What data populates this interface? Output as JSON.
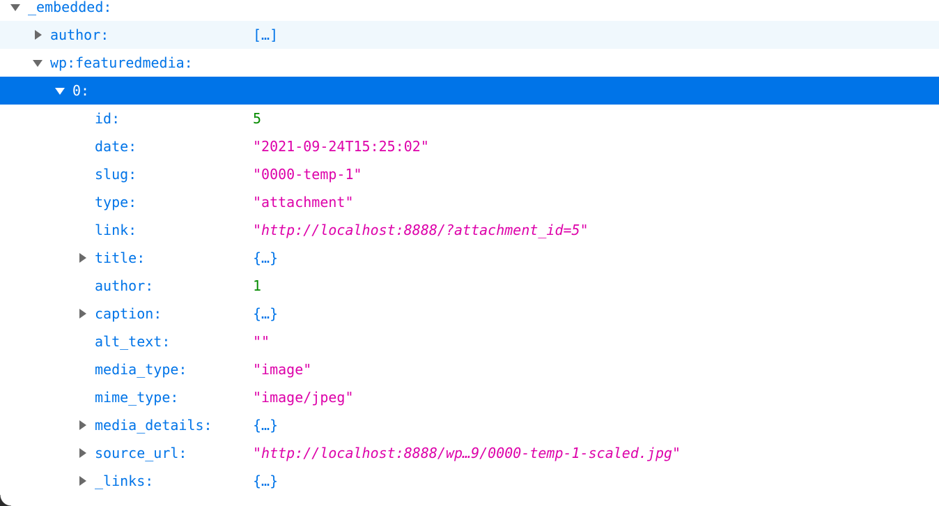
{
  "tree": {
    "rows": [
      {
        "key": "_embedded:",
        "value": "",
        "type": "none",
        "depth": 0,
        "twisty": "expanded",
        "state": ""
      },
      {
        "key": "author:",
        "value": "[…]",
        "type": "obj",
        "depth": 1,
        "twisty": "collapsed",
        "state": "hover"
      },
      {
        "key": "wp:featuredmedia:",
        "value": "",
        "type": "none",
        "depth": 1,
        "twisty": "expanded",
        "state": ""
      },
      {
        "key": "0:",
        "value": "",
        "type": "none",
        "depth": 2,
        "twisty": "expanded",
        "state": "selected"
      },
      {
        "key": "id:",
        "value": "5",
        "type": "number",
        "depth": 3,
        "twisty": "none",
        "state": ""
      },
      {
        "key": "date:",
        "value": "\"2021-09-24T15:25:02\"",
        "type": "string",
        "depth": 3,
        "twisty": "none",
        "state": ""
      },
      {
        "key": "slug:",
        "value": "\"0000-temp-1\"",
        "type": "string",
        "depth": 3,
        "twisty": "none",
        "state": ""
      },
      {
        "key": "type:",
        "value": "\"attachment\"",
        "type": "string",
        "depth": 3,
        "twisty": "none",
        "state": ""
      },
      {
        "key": "link:",
        "value": "\"http://localhost:8888/?attachment_id=5\"",
        "type": "url",
        "depth": 3,
        "twisty": "none",
        "state": ""
      },
      {
        "key": "title:",
        "value": "{…}",
        "type": "obj",
        "depth": 3,
        "twisty": "collapsed",
        "state": ""
      },
      {
        "key": "author:",
        "value": "1",
        "type": "number",
        "depth": 3,
        "twisty": "none",
        "state": ""
      },
      {
        "key": "caption:",
        "value": "{…}",
        "type": "obj",
        "depth": 3,
        "twisty": "collapsed",
        "state": ""
      },
      {
        "key": "alt_text:",
        "value": "\"\"",
        "type": "string",
        "depth": 3,
        "twisty": "none",
        "state": ""
      },
      {
        "key": "media_type:",
        "value": "\"image\"",
        "type": "string",
        "depth": 3,
        "twisty": "none",
        "state": ""
      },
      {
        "key": "mime_type:",
        "value": "\"image/jpeg\"",
        "type": "string",
        "depth": 3,
        "twisty": "none",
        "state": ""
      },
      {
        "key": "media_details:",
        "value": "{…}",
        "type": "obj",
        "depth": 3,
        "twisty": "collapsed",
        "state": ""
      },
      {
        "key": "source_url:",
        "value": "\"http://localhost:8888/wp…9/0000-temp-1-scaled.jpg\"",
        "type": "url",
        "depth": 3,
        "twisty": "collapsed",
        "state": ""
      },
      {
        "key": "_links:",
        "value": "{…}",
        "type": "obj",
        "depth": 3,
        "twisty": "collapsed",
        "state": ""
      }
    ]
  },
  "colors": {
    "key": "#0074e8",
    "string": "#dd00a9",
    "number": "#058b00",
    "selected_row": "#0074e8",
    "hover_row": "#f0f8fd"
  }
}
